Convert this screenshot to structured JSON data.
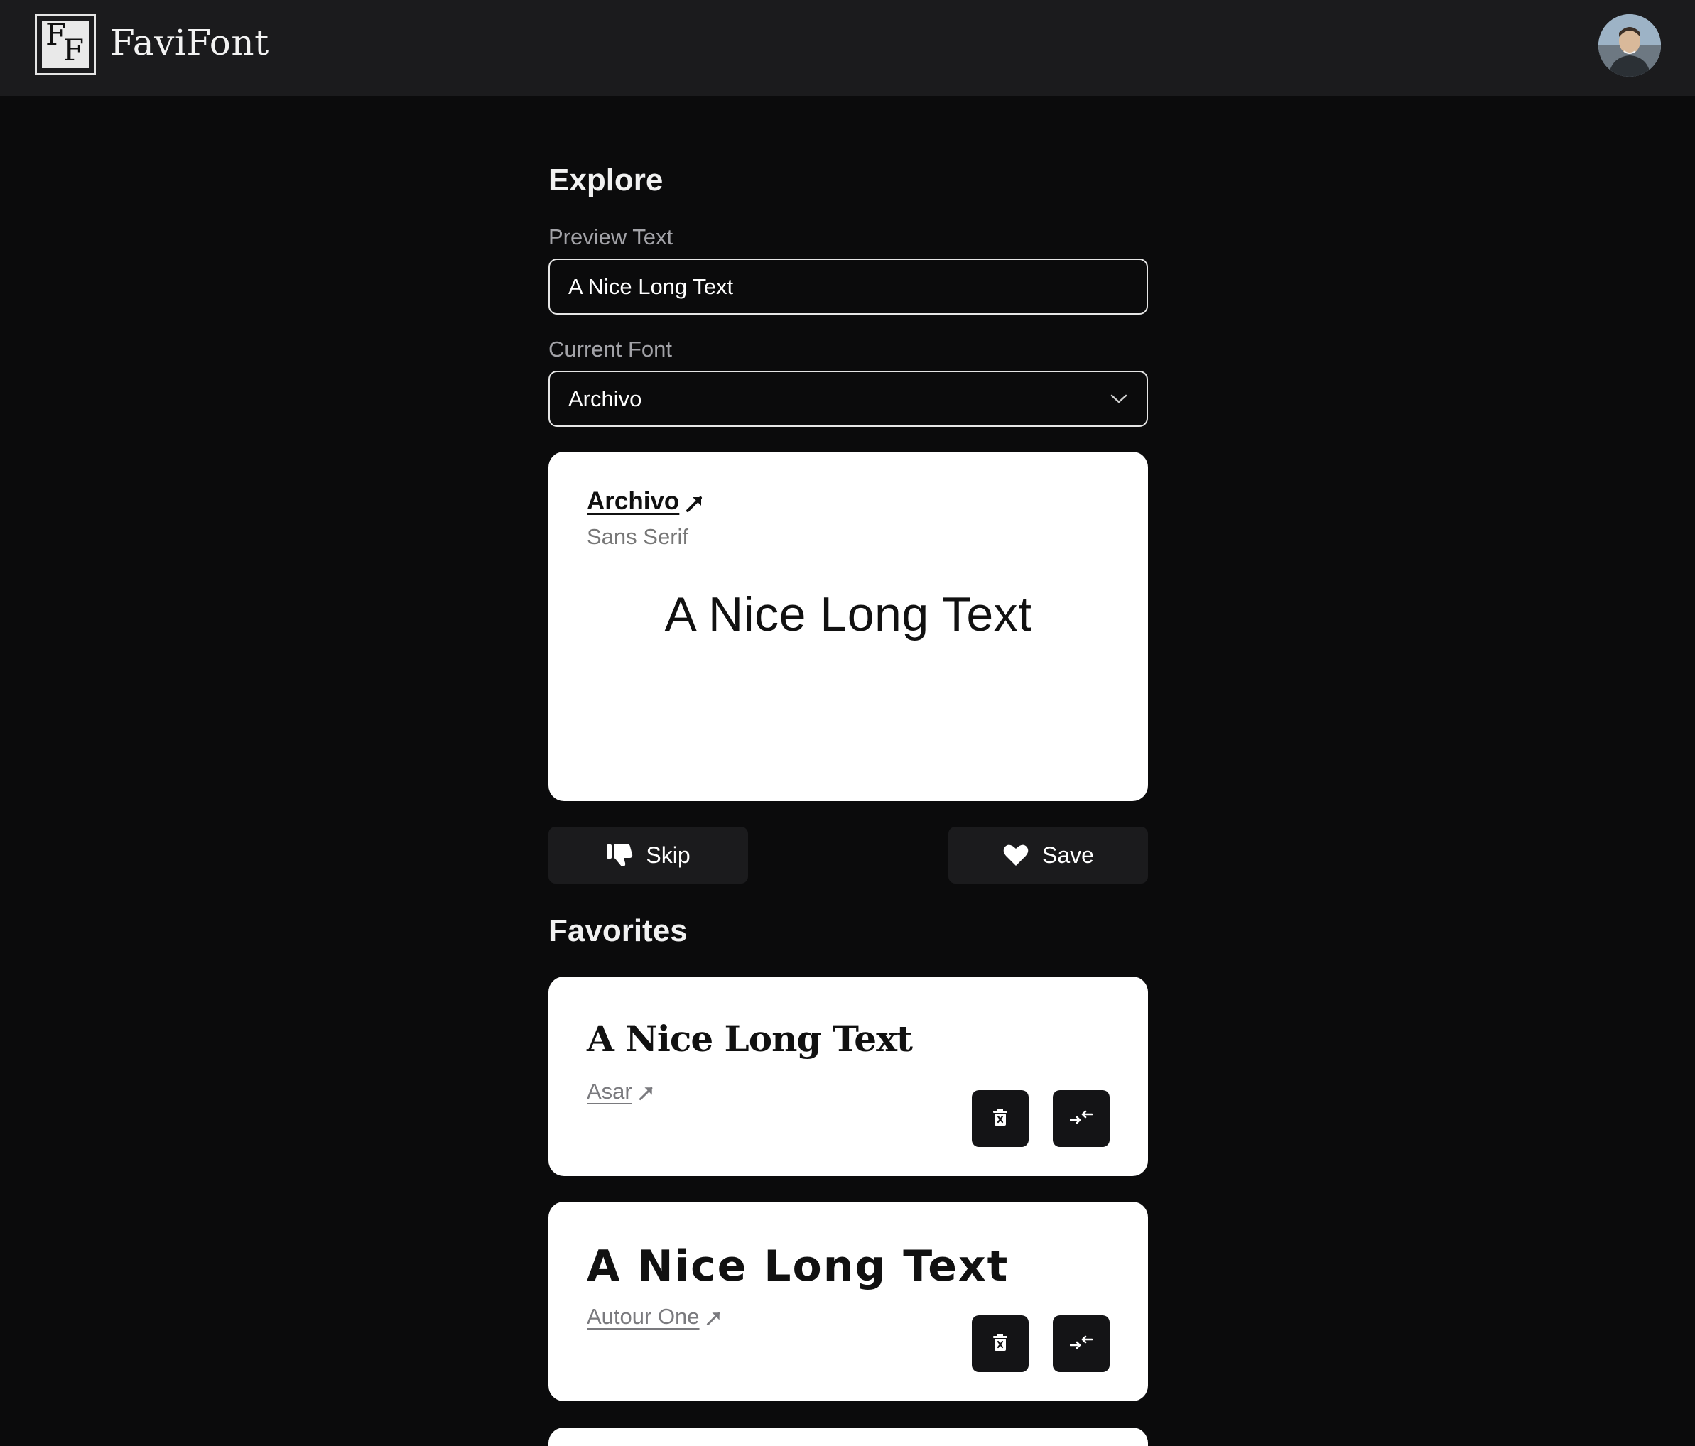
{
  "header": {
    "logo_letter_1": "F",
    "logo_letter_2": "F",
    "brand": "FaviFont"
  },
  "explore": {
    "title": "Explore",
    "preview_text_label": "Preview Text",
    "preview_text_value": "A Nice Long Text",
    "current_font_label": "Current Font",
    "current_font_value": "Archivo"
  },
  "preview_card": {
    "font_name": "Archivo",
    "category": "Sans Serif",
    "sample": "A Nice Long Text"
  },
  "actions": {
    "skip_label": "Skip",
    "save_label": "Save"
  },
  "favorites": {
    "title": "Favorites",
    "items": [
      {
        "sample": "A Nice Long Text",
        "font_name": "Asar"
      },
      {
        "sample": "A Nice Long Text",
        "font_name": "Autour One"
      }
    ]
  },
  "icons": {
    "logo": "ff-logo",
    "avatar": "user-avatar",
    "select": "chevron-down-icon",
    "external_link": "arrow-up-right-icon",
    "skip": "thumbs-down-icon",
    "save": "heart-icon",
    "delete": "trash-icon",
    "apply": "swap-arrows-icon"
  }
}
